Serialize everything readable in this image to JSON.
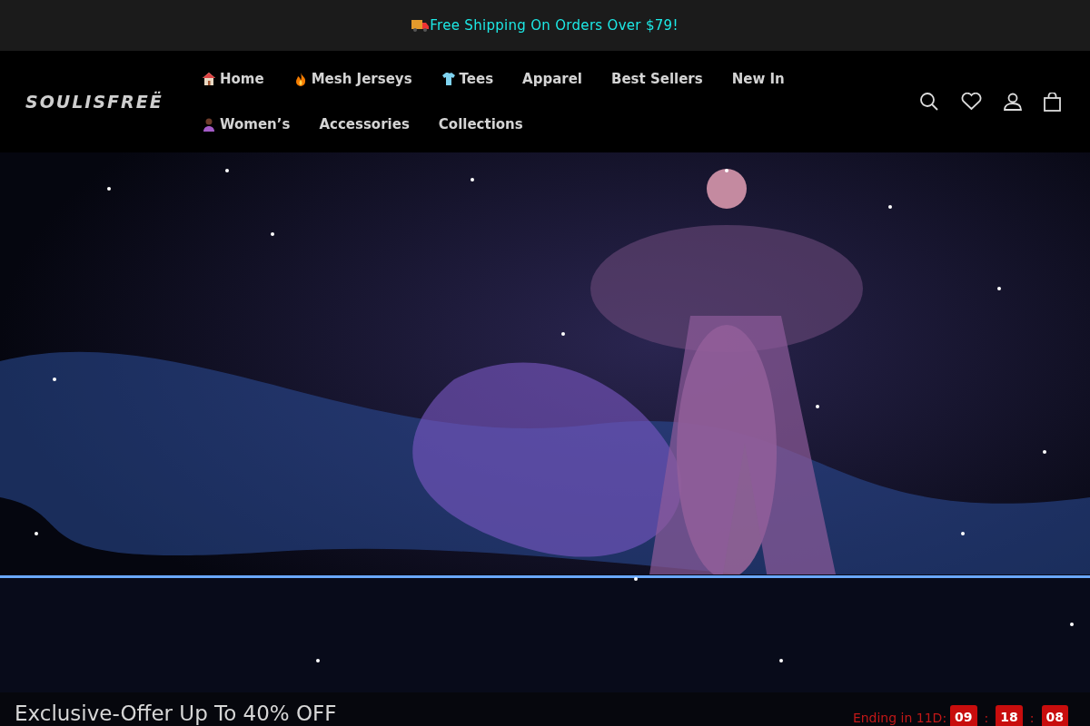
{
  "announcement": {
    "text": "Free Shipping On Orders Over $79!"
  },
  "logo": {
    "text": "SOULISFREË"
  },
  "nav": [
    {
      "label": "Home",
      "kind": "house"
    },
    {
      "label": "Mesh Jerseys",
      "kind": "flame"
    },
    {
      "label": "Tees",
      "kind": "shirt"
    },
    {
      "label": "Apparel",
      "kind": "plain"
    },
    {
      "label": "Best Sellers",
      "kind": "plain"
    },
    {
      "label": "New In",
      "kind": "plain"
    },
    {
      "label": "Women’s",
      "kind": "singer"
    },
    {
      "label": "Accessories",
      "kind": "plain"
    },
    {
      "label": "Collections",
      "kind": "plain"
    }
  ],
  "offer_bar": {
    "title": "Exclusive-Offer Up To 40% OFF",
    "countdown_label": "Ending in 11D:",
    "hours": "09",
    "separator_1": ":",
    "minutes": "18",
    "separator_2": ":",
    "seconds": "08"
  }
}
